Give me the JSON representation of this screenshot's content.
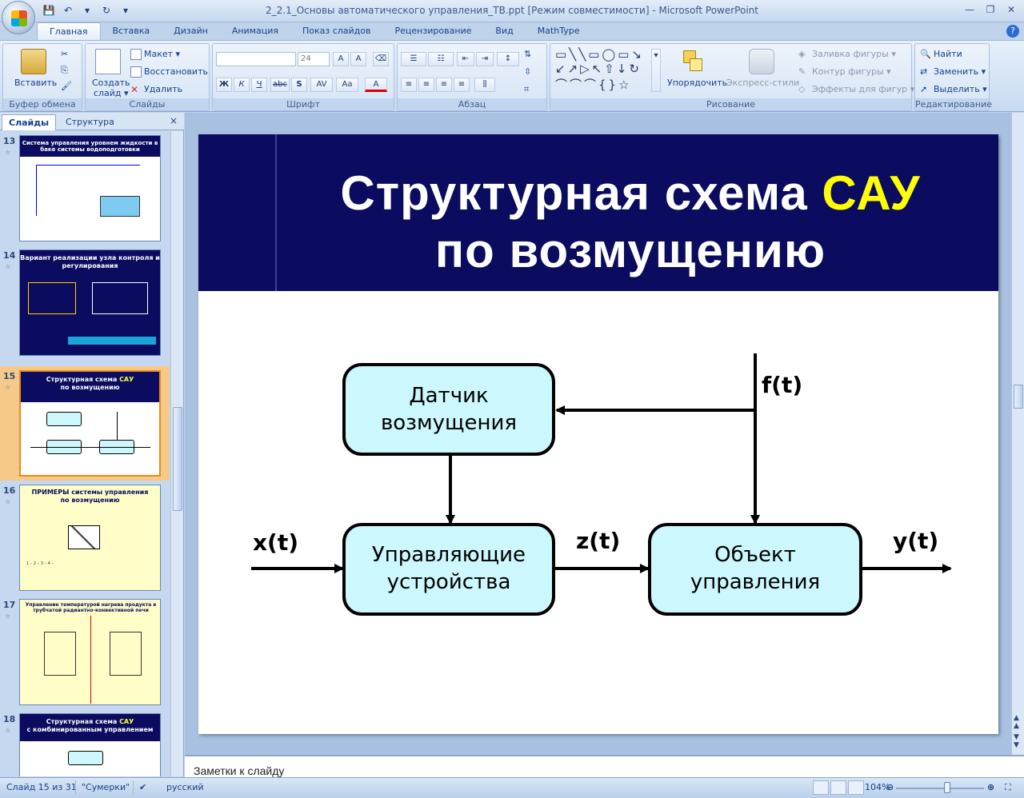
{
  "window": {
    "title": "2_2.1_Основы автоматического управления_ТВ.ppt [Режим совместимости] - Microsoft PowerPoint"
  },
  "tabs": [
    "Главная",
    "Вставка",
    "Дизайн",
    "Анимация",
    "Показ слайдов",
    "Рецензирование",
    "Вид",
    "MathType"
  ],
  "ribbon": {
    "clipboard": {
      "paste": "Вставить",
      "label": "Буфер обмена"
    },
    "slides": {
      "create": "Создать",
      "create2": "слайд",
      "layout": "Макет",
      "reset": "Восстановить",
      "delete": "Удалить",
      "label": "Слайды"
    },
    "font": {
      "size": "24",
      "label": "Шрифт",
      "bold": "Ж",
      "italic": "К",
      "underline": "Ч",
      "strike": "abc",
      "shadow": "S"
    },
    "paragraph": {
      "label": "Абзац"
    },
    "drawing": {
      "arrange": "Упорядочить",
      "quick_styles": "Экспресс-стили",
      "fill": "Заливка фигуры",
      "outline": "Контур фигуры",
      "effects": "Эффекты для фигур",
      "label": "Рисование"
    },
    "editing": {
      "find": "Найти",
      "replace": "Заменить",
      "select": "Выделить",
      "label": "Редактирование"
    }
  },
  "left_pane": {
    "tab_slides": "Слайды",
    "tab_outline": "Структура",
    "close": "×",
    "thumbnails": [
      {
        "num": "13",
        "title": "Система управления уровнем жидкости в баке системы водоподготовки"
      },
      {
        "num": "14",
        "title": "Вариант реализации узла контроля и регулирования"
      },
      {
        "num": "15",
        "title_a": "Структурная схема ",
        "title_hl": "САУ",
        "title_b": "по возмущению"
      },
      {
        "num": "16",
        "title": "ПРИМЕРЫ системы управления по возмущению"
      },
      {
        "num": "17",
        "title": "Управление температурой нагрева продукта в трубчатой радиантно-конвективной печи"
      },
      {
        "num": "18",
        "title_a": "Структурная схема ",
        "title_hl": "САУ",
        "title_b": "с комбинированным управлением"
      }
    ]
  },
  "slide": {
    "title_line1_a": "Структурная схема ",
    "title_line1_hl": "САУ",
    "title_line2": "по возмущению",
    "diagram": {
      "sensor_l1": "Датчик",
      "sensor_l2": "возмущения",
      "controller_l1": "Управляющие",
      "controller_l2": "устройства",
      "object_l1": "Объект",
      "object_l2": "управления",
      "f": "f(t)",
      "x": "x(t)",
      "z": "z(t)",
      "y": "y(t)"
    }
  },
  "notes": {
    "placeholder": "Заметки к слайду"
  },
  "status": {
    "slide": "Слайд 15 из 31",
    "theme": "\"Сумерки\"",
    "language": "русский",
    "zoom": "104%"
  },
  "colors": {
    "slide_header": "#0b0b5f",
    "highlight": "#ffff00",
    "box_fill": "#ccf7fc"
  }
}
